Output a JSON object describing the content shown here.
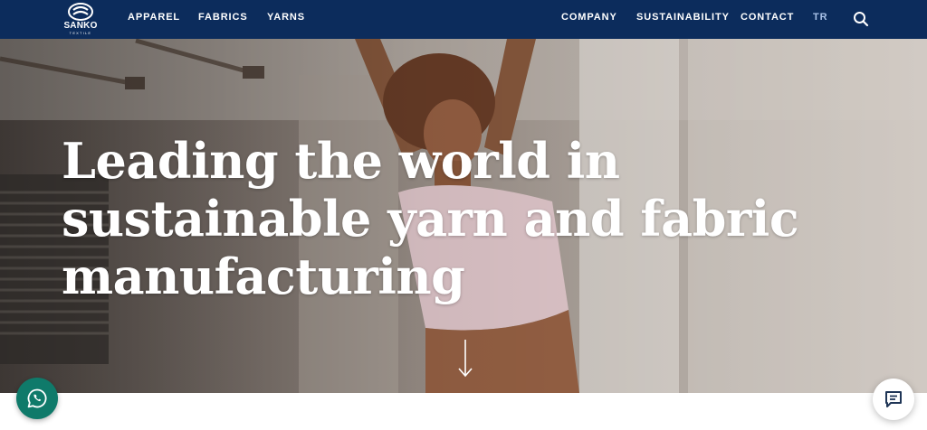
{
  "brand": {
    "name": "SANKO",
    "sub": "TEXTILE"
  },
  "nav": {
    "left": [
      {
        "label": "APPAREL"
      },
      {
        "label": "FABRICS"
      },
      {
        "label": "YARNS"
      }
    ],
    "right": [
      {
        "label": "COMPANY"
      },
      {
        "label": "SUSTAINABILITY"
      },
      {
        "label": "CONTACT"
      }
    ],
    "lang": "TR"
  },
  "hero": {
    "title_lines": [
      "Leading the world in",
      "sustainable yarn and fabric",
      "manufacturing"
    ]
  },
  "icons": {
    "search": "search-icon",
    "scroll": "arrow-down-icon",
    "whatsapp": "whatsapp-icon",
    "chat": "chat-icon"
  },
  "colors": {
    "navbar": "#0c2c5c",
    "language_link": "#a9c2e8",
    "whatsapp": "#0f7a6a",
    "chat_icon": "#1f3556"
  }
}
